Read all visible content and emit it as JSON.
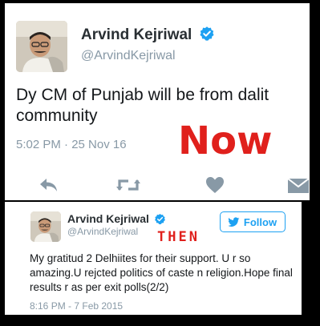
{
  "now_tweet": {
    "author_name": "Arvind Kejriwal",
    "author_handle": "@ArvindKejriwal",
    "text": "Dy CM of Punjab will be from dalit community",
    "timestamp": "5:02 PM · 25 Nov 16",
    "overlay_label": "Now",
    "actions": [
      "reply-icon",
      "retweet-icon",
      "like-icon",
      "message-icon"
    ]
  },
  "then_tweet": {
    "author_name": "Arvind Kejriwal",
    "author_handle": "@ArvindKejriwal",
    "text": "My gratitud 2 Delhiites for their support. U r so amazing.U rejcted politics of caste n religion.Hope final results r as per exit polls(2/2)",
    "timestamp": "8:16 PM - 7 Feb 2015",
    "overlay_label": "THEN",
    "follow_label": "Follow"
  },
  "colors": {
    "accent": "#1da1f2",
    "overlay": "#e0201c",
    "muted": "#8899a6",
    "text": "#14171a",
    "background": "#000000"
  }
}
